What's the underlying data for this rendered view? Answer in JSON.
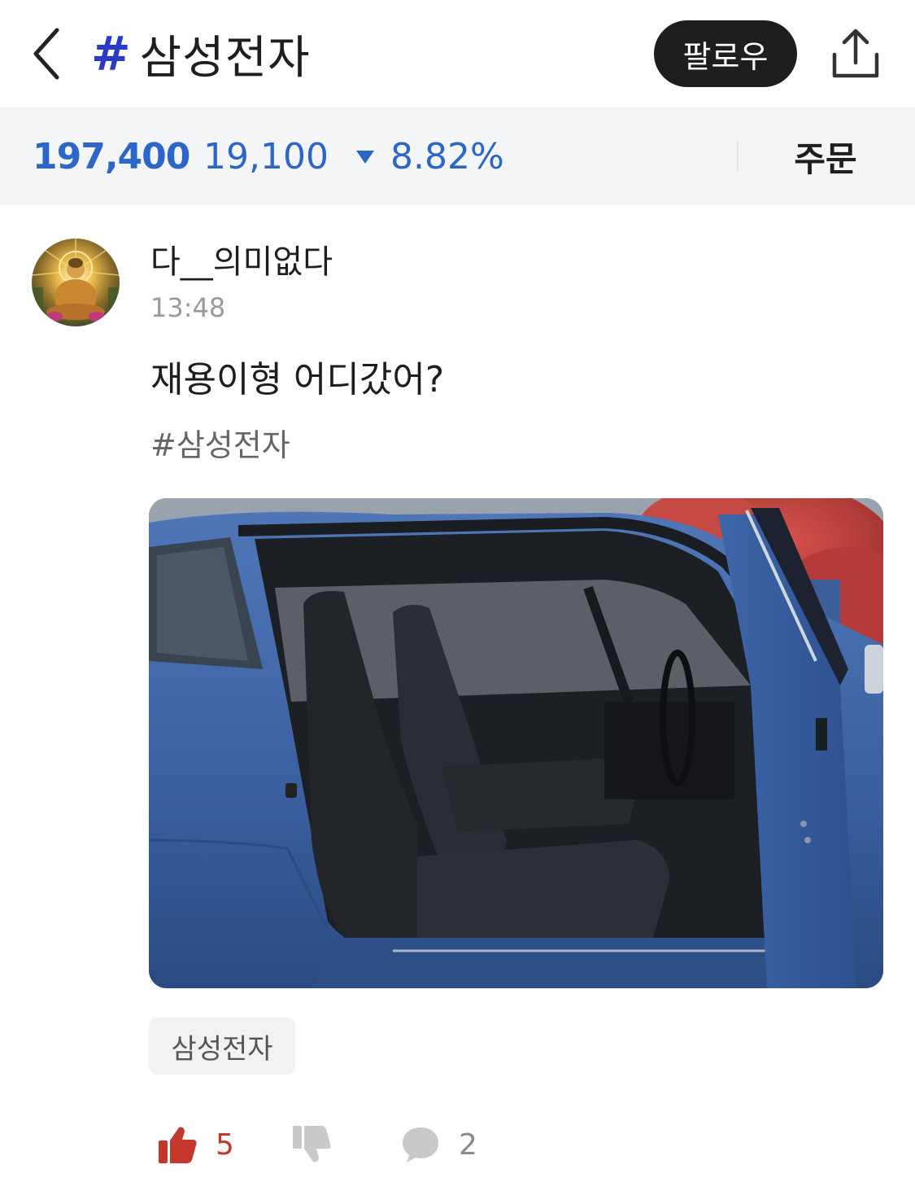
{
  "header": {
    "title_hash": "#",
    "title": "삼성전자",
    "follow_label": "팔로우"
  },
  "stock": {
    "price": "197,400",
    "change": "19,100",
    "change_pct": "8.82%",
    "direction": "down",
    "order_label": "주문"
  },
  "post": {
    "author": "다__의미없다",
    "time": "13:48",
    "text": "재용이형 어디갔어?",
    "hashtag": "#삼성전자",
    "tag_chip": "삼성전자"
  },
  "actions": {
    "likes": "5",
    "comments": "2"
  },
  "colors": {
    "accent_blue": "#2c66c8",
    "hash_blue": "#2a3cc7",
    "like_red": "#c4382c",
    "follow_bg": "#1e1e1e"
  },
  "icons": [
    "back-arrow-icon",
    "share-icon",
    "thumbs-up-icon",
    "thumbs-down-icon",
    "comment-icon"
  ]
}
